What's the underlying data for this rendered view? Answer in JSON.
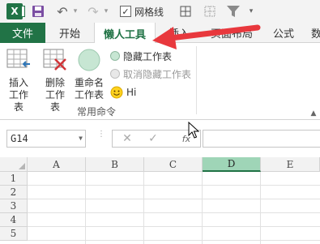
{
  "quick_access": {
    "excel_logo": "X",
    "gridlines_label": "网格线",
    "gridlines_checked": "✓",
    "icons": [
      "excel-logo-icon",
      "save-icon",
      "undo-icon",
      "redo-icon",
      "border-all-icon",
      "border-none-icon",
      "filter-icon"
    ]
  },
  "tabs": [
    {
      "label": "文件"
    },
    {
      "label": "开始"
    },
    {
      "label": "懒人工具"
    },
    {
      "label": "插入"
    },
    {
      "label": "页面布局"
    },
    {
      "label": "公式"
    },
    {
      "label": "数"
    }
  ],
  "ribbon": {
    "buttons": [
      {
        "line1": "插入",
        "line2": "工作表",
        "icon": "insert-sheet-icon"
      },
      {
        "line1": "删除",
        "line2": "工作表",
        "icon": "delete-sheet-icon"
      },
      {
        "line1": "重命名",
        "line2": "工作表",
        "icon": "rename-sheet-icon"
      }
    ],
    "small_buttons": [
      {
        "label": "隐藏工作表",
        "enabled": true
      },
      {
        "label": "取消隐藏工作表",
        "enabled": false
      },
      {
        "label": "Hi",
        "icon": "smiley-icon"
      }
    ],
    "group_label": "常用命令"
  },
  "formula_bar": {
    "name_box": "G14",
    "fx": "fx",
    "formula": ""
  },
  "grid": {
    "columns": [
      "A",
      "B",
      "C",
      "D",
      "E"
    ],
    "selected_column": "D",
    "rows": [
      "1",
      "2",
      "3",
      "4",
      "5"
    ]
  },
  "colors": {
    "accent": "#217346",
    "selected_header": "#9fd5b7",
    "annotation_arrow": "#e8383d"
  }
}
